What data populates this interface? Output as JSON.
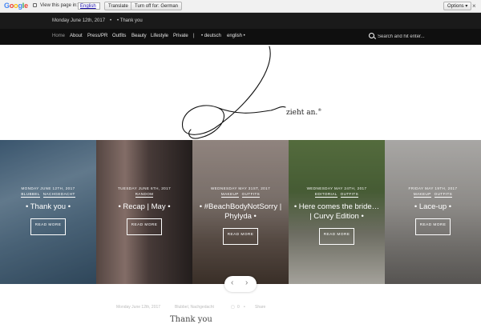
{
  "translate_bar": {
    "logo": "Google",
    "prompt": "View this page in:",
    "language": "English",
    "translate_btn": "Translate",
    "turn_off_btn": "Turn off for: German",
    "options_btn": "Options ▾",
    "close": "×"
  },
  "topbar": {
    "date": "Monday June 12th, 2017",
    "separator": "•",
    "latest": "• Thank you"
  },
  "nav": {
    "items": [
      "Home",
      "About",
      "Press/PR",
      "Outfits",
      "Beauty",
      "Lifestyle",
      "Private",
      "|",
      "• deutsch",
      "english •"
    ],
    "search_placeholder": "Search and hit enter..."
  },
  "logo": {
    "text": "zieht an.",
    "mark": "®"
  },
  "slides": [
    {
      "date": "Monday June 12th, 2017",
      "cats": [
        "Blubbel",
        "Nachgedacht"
      ],
      "title": "• Thank you •",
      "read_more": "READ MORE"
    },
    {
      "date": "Tuesday June 6th, 2017",
      "cats": [
        "Random"
      ],
      "title": "• Recap | May •",
      "read_more": "READ MORE"
    },
    {
      "date": "Wednesday May 31st, 2017",
      "cats": [
        "Makeup",
        "Outfits"
      ],
      "title": "• #BeachBodyNotSorry | Phylyda •",
      "read_more": "READ MORE"
    },
    {
      "date": "Wednesday May 24th, 2017",
      "cats": [
        "Editorial",
        "Outfits"
      ],
      "title": "• Here comes the bride… | Curvy Edition •",
      "read_more": "READ MORE"
    },
    {
      "date": "Friday May 19th, 2017",
      "cats": [
        "Makeup",
        "Outfits"
      ],
      "title": "• Lace-up •",
      "read_more": "READ MORE"
    }
  ],
  "slider_nav": {
    "prev": "‹",
    "next": "›"
  },
  "post_meta": {
    "date": "Monday June 12th, 2017",
    "cats": "Blubbel, Nachgedacht",
    "comments": "0",
    "share": "Share"
  },
  "post_title_peek": "Thank you"
}
